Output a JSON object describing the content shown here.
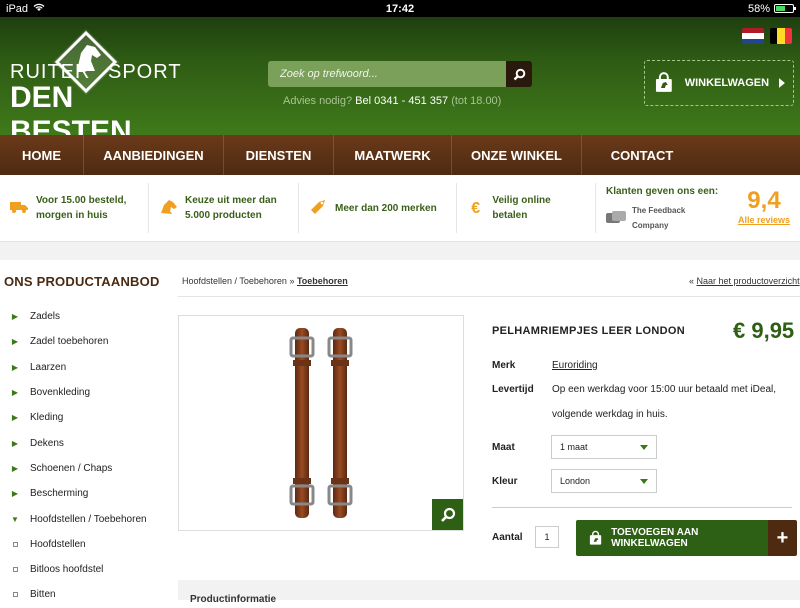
{
  "status_bar": {
    "device": "iPad",
    "time": "17:42",
    "battery": "58%",
    "battery_level": 0.58
  },
  "logo": {
    "line1_left": "RUITER",
    "line1_right": "SPORT",
    "line2": "DEN BESTEN"
  },
  "search": {
    "placeholder": "Zoek op trefwoord..."
  },
  "advice": {
    "prefix": "Advies nodig?",
    "phone": "Bel 0341 - 451 357",
    "hours": "(tot 18.00)"
  },
  "cart": {
    "label": "WINKELWAGEN"
  },
  "colors": {
    "header_green": "#2e5a14",
    "nav_brown": "#4e2a11",
    "accent_orange": "#f0a020",
    "button_green": "#2d5f14"
  },
  "nav": [
    {
      "label": "HOME"
    },
    {
      "label": "AANBIEDINGEN"
    },
    {
      "label": "DIENSTEN"
    },
    {
      "label": "MAATWERK"
    },
    {
      "label": "ONZE WINKEL"
    },
    {
      "label": "CONTACT"
    }
  ],
  "usp": [
    {
      "icon": "truck-icon",
      "line1": "Voor 15.00 besteld,",
      "line2": "morgen in huis"
    },
    {
      "icon": "horse-head-icon",
      "line1": "Keuze uit meer dan",
      "line2": "5.000 producten"
    },
    {
      "icon": "tag-icon",
      "line1": "Meer dan 200 merken",
      "line2": ""
    },
    {
      "icon": "euro-icon",
      "line1": "Veilig online betalen",
      "line2": ""
    }
  ],
  "feedback": {
    "label": "Klanten geven ons een:",
    "company": "The Feedback Company",
    "score": "9,4",
    "reviews": "Alle reviews"
  },
  "sidebar": {
    "title": "ONS PRODUCTAANBOD",
    "items": [
      {
        "label": "Zadels",
        "type": "cat"
      },
      {
        "label": "Zadel toebehoren",
        "type": "cat"
      },
      {
        "label": "Laarzen",
        "type": "cat"
      },
      {
        "label": "Bovenkleding",
        "type": "cat"
      },
      {
        "label": "Kleding",
        "type": "cat"
      },
      {
        "label": "Dekens",
        "type": "cat"
      },
      {
        "label": "Schoenen / Chaps",
        "type": "cat"
      },
      {
        "label": "Bescherming",
        "type": "cat"
      },
      {
        "label": "Hoofdstellen / Toebehoren",
        "type": "open"
      },
      {
        "label": "Hoofdstellen",
        "type": "sub"
      },
      {
        "label": "Bitloos hoofdstel",
        "type": "sub"
      },
      {
        "label": "Bitten",
        "type": "sub"
      }
    ]
  },
  "breadcrumb": {
    "parent": "Hoofdstellen / Toebehoren",
    "separator": "»",
    "current": "Toebehoren"
  },
  "back_link": {
    "prefix": "«",
    "label": "Naar het productoverzicht"
  },
  "product": {
    "title": "PELHAMRIEMPJES LEER LONDON",
    "price": "€ 9,95",
    "brand_label": "Merk",
    "brand": "Euroriding",
    "delivery_label": "Levertijd",
    "delivery_line1": "Op een werkdag voor 15:00 uur betaald met iDeal,",
    "delivery_line2": "volgende werkdag in huis.",
    "size_label": "Maat",
    "size_value": "1 maat",
    "color_label": "Kleur",
    "color_value": "London",
    "qty_label": "Aantal",
    "qty_value": "1",
    "add_button": "TOEVOEGEN AAN WINKELWAGEN",
    "plus": "+"
  },
  "bottom": {
    "label": "Productinformatie"
  }
}
